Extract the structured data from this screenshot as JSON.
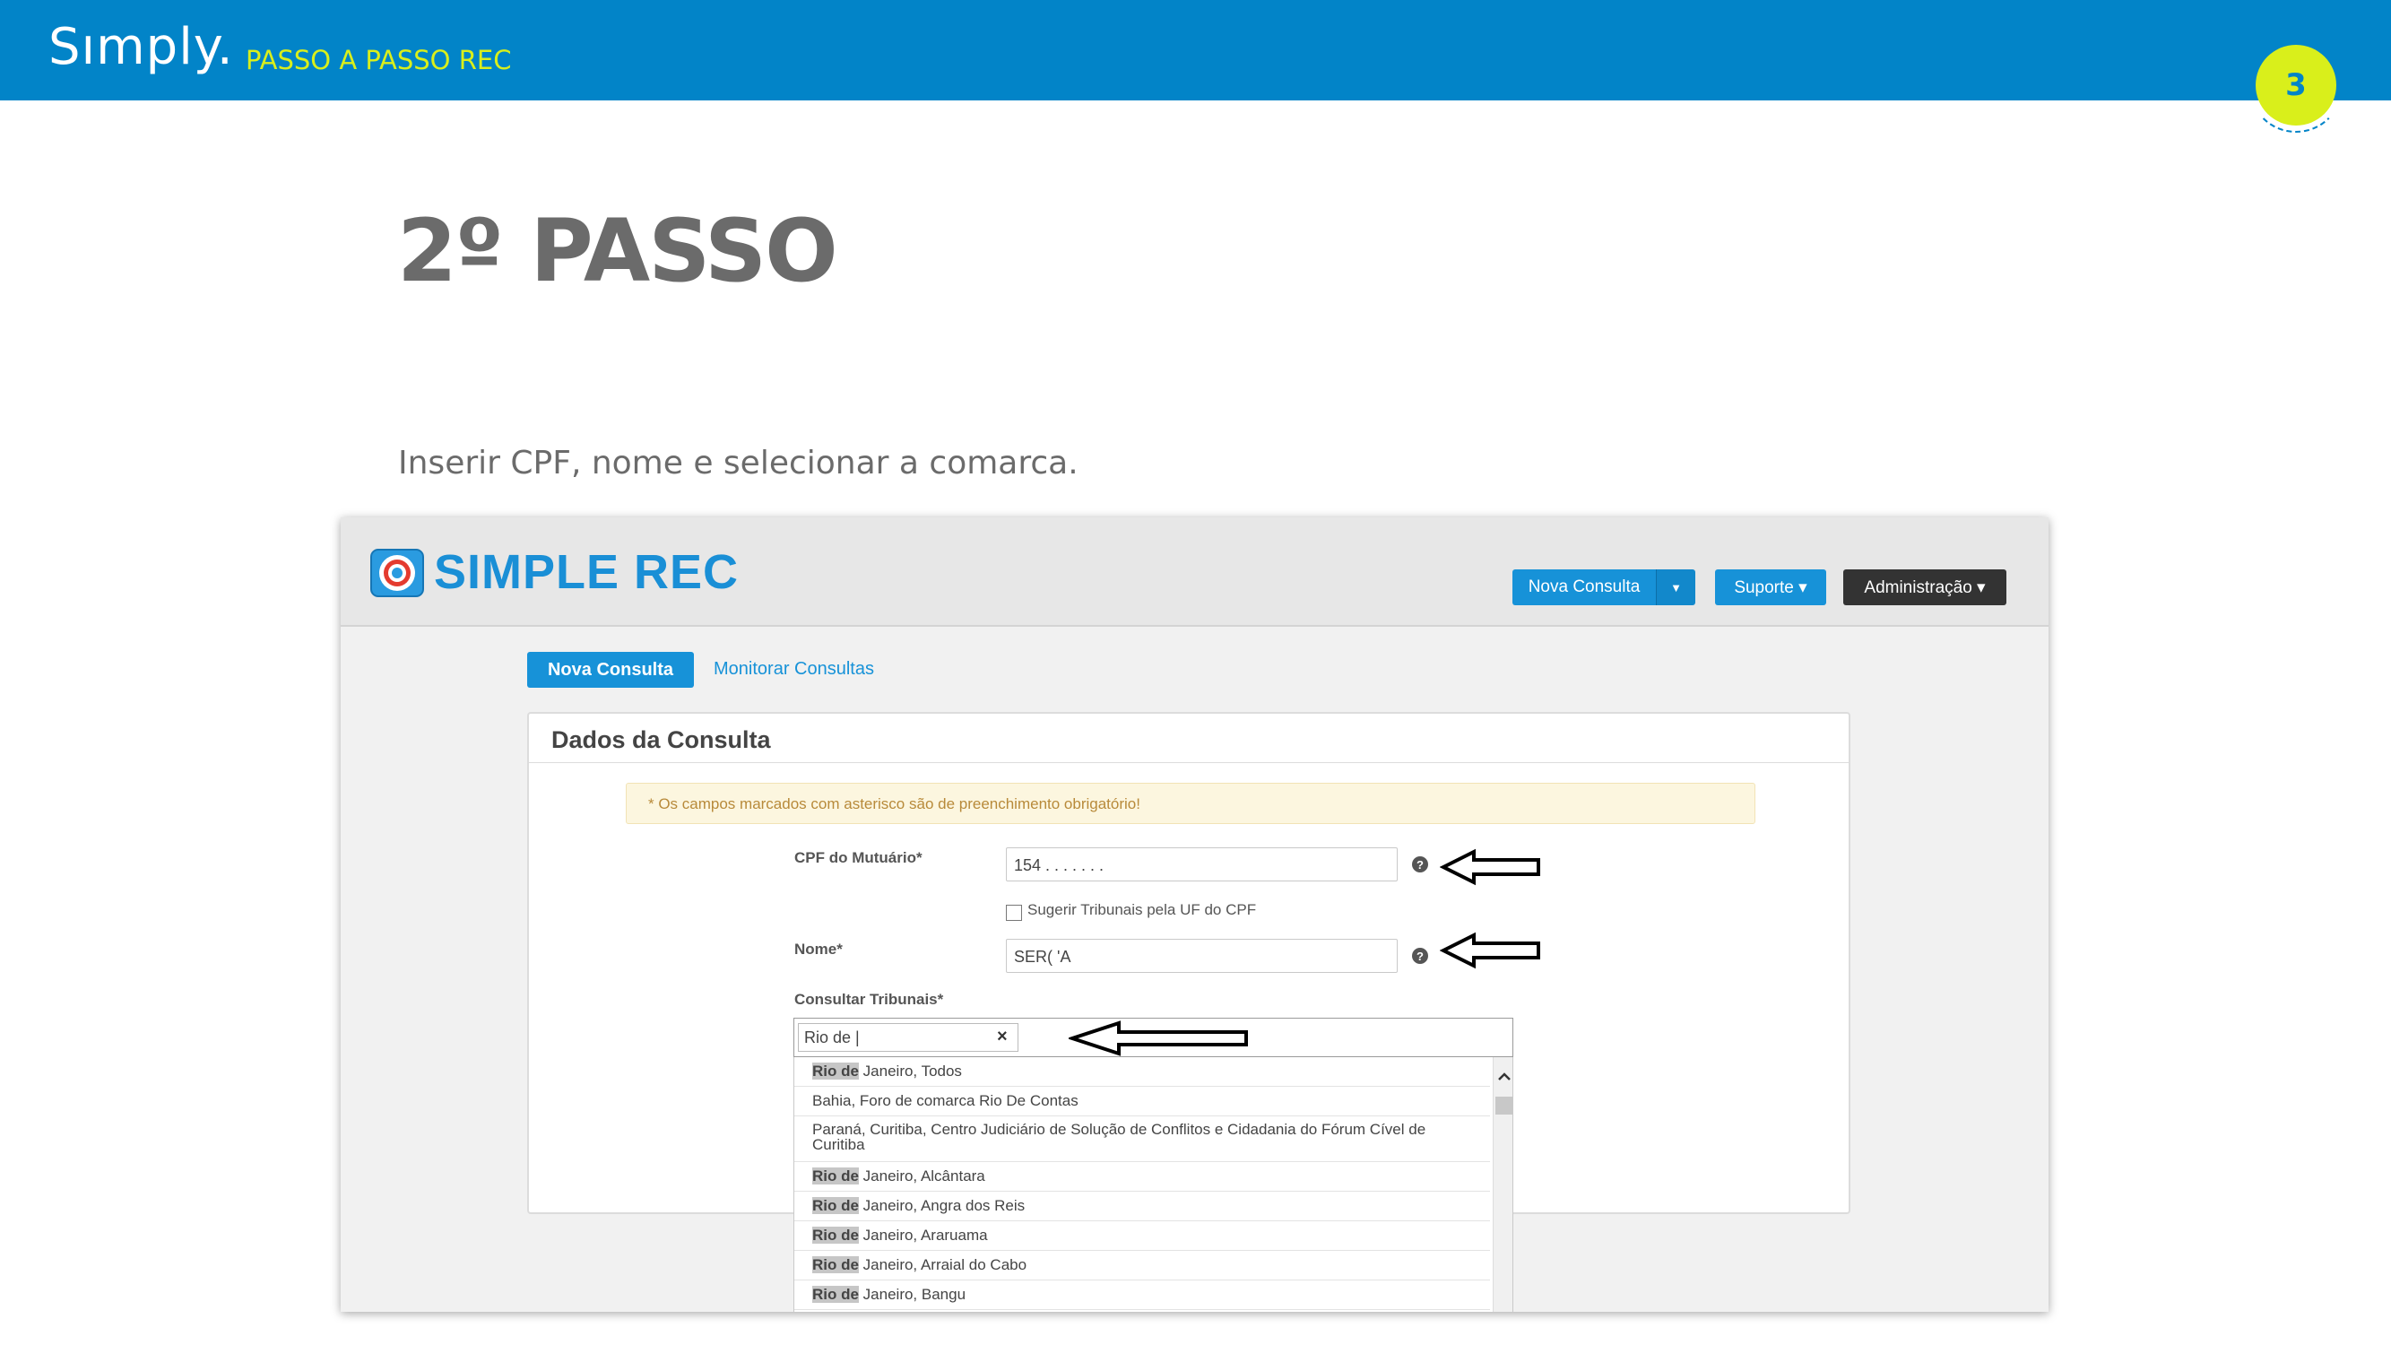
{
  "slide": {
    "brand": "Sımply.",
    "section": "PASSO A PASSO REC",
    "page_number": "3",
    "title": "2º PASSO",
    "description": "Inserir CPF, nome e selecionar a comarca."
  },
  "app": {
    "logo_text": "SIMPLE REC",
    "header_buttons": {
      "nova_consulta": "Nova Consulta",
      "suporte": "Suporte ▾",
      "administracao": "Administração ▾"
    },
    "tabs": {
      "active": "Nova Consulta",
      "link": "Monitorar Consultas"
    },
    "panel": {
      "title": "Dados da Consulta",
      "notice": "* Os campos marcados com asterisco são de preenchimento obrigatório!",
      "cpf_label": "CPF do Mutuário*",
      "cpf_value": "154 . . . . . . .",
      "suggest_label": "Sugerir Tribunais pela UF do CPF",
      "nome_label": "Nome*",
      "nome_value": "SER(                              'A",
      "tribunais_label": "Consultar Tribunais*",
      "search_value": "Rio de |"
    },
    "dropdown_options": [
      {
        "prefix": "Rio de",
        "rest": " Janeiro, Todos"
      },
      {
        "prefix": "",
        "rest": "Bahia, Foro de comarca Rio De Contas"
      },
      {
        "prefix": "",
        "rest": "Paraná, Curitiba, Centro Judiciário de Solução de Conflitos e Cidadania do Fórum Cível de Curitiba"
      },
      {
        "prefix": "Rio de",
        "rest": " Janeiro, Alcântara"
      },
      {
        "prefix": "Rio de",
        "rest": " Janeiro, Angra dos Reis"
      },
      {
        "prefix": "Rio de",
        "rest": " Janeiro, Araruama"
      },
      {
        "prefix": "Rio de",
        "rest": " Janeiro, Arraial do Cabo"
      },
      {
        "prefix": "Rio de",
        "rest": " Janeiro, Bangu"
      }
    ]
  },
  "colors": {
    "topbar": "#0284c8",
    "accent_yellow": "#d9ef1b",
    "button_blue": "#1792d8",
    "title_gray": "#6b6b6b"
  }
}
